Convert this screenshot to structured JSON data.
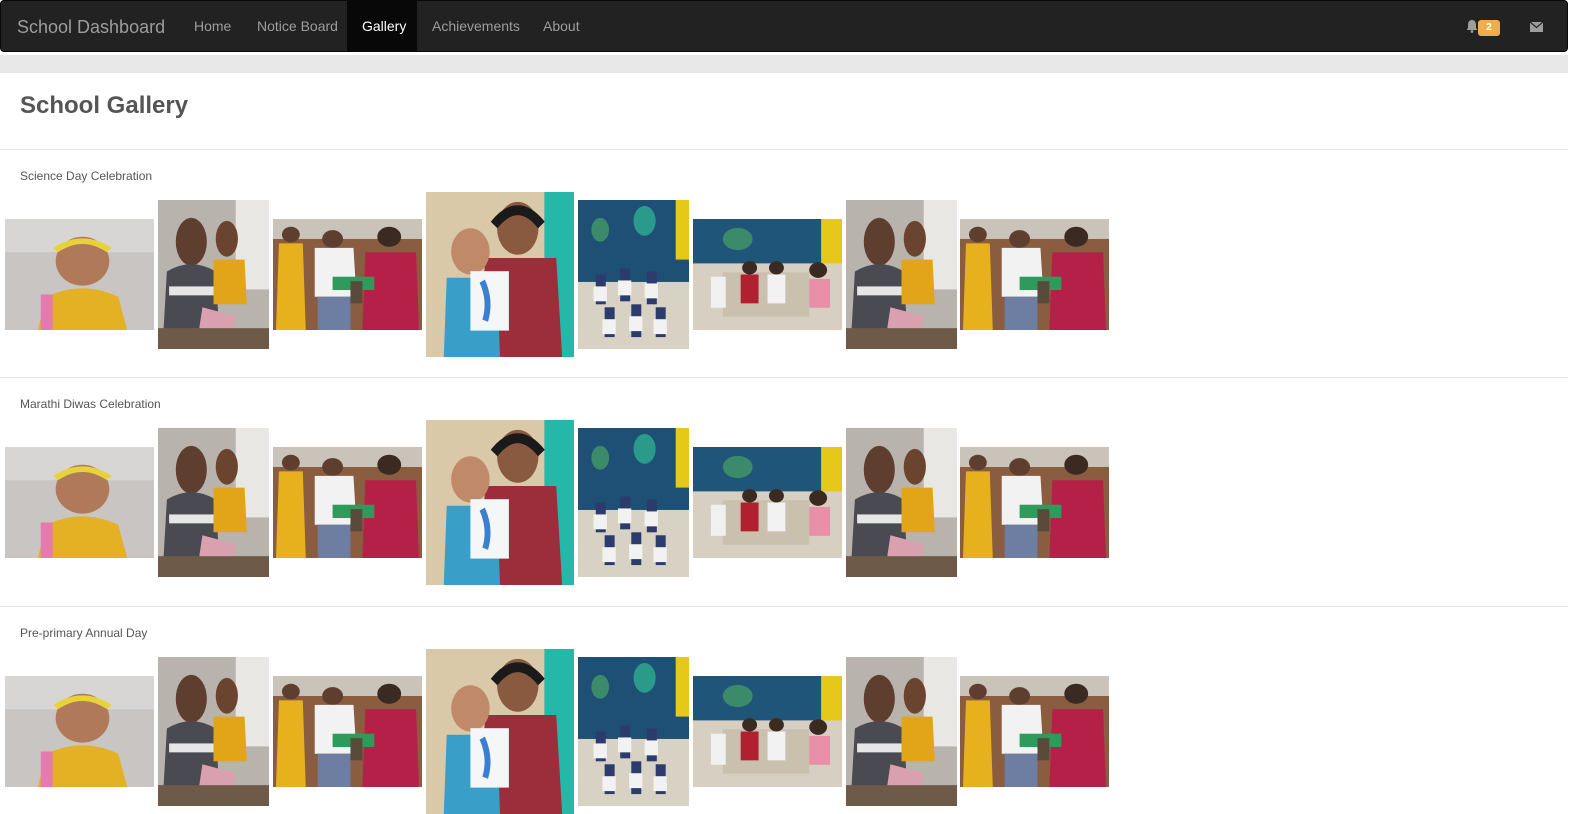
{
  "nav": {
    "brand": "School Dashboard",
    "items": [
      {
        "label": "Home",
        "active": false
      },
      {
        "label": "Notice Board",
        "active": false
      },
      {
        "label": "Gallery",
        "active": true
      },
      {
        "label": "Achievements",
        "active": false
      },
      {
        "label": "About",
        "active": false
      }
    ],
    "notification_count": "2",
    "icons": [
      "bell-icon",
      "envelope-icon"
    ]
  },
  "page": {
    "title": "School Gallery"
  },
  "sections": [
    {
      "title": "Science Day Celebration"
    },
    {
      "title": "Marathi Diwas Celebration"
    },
    {
      "title": "Pre-primary Annual Day"
    }
  ],
  "colors": {
    "navbar_bg": "#222222",
    "active_nav_bg": "#080808",
    "badge": "#f0ad4e"
  }
}
